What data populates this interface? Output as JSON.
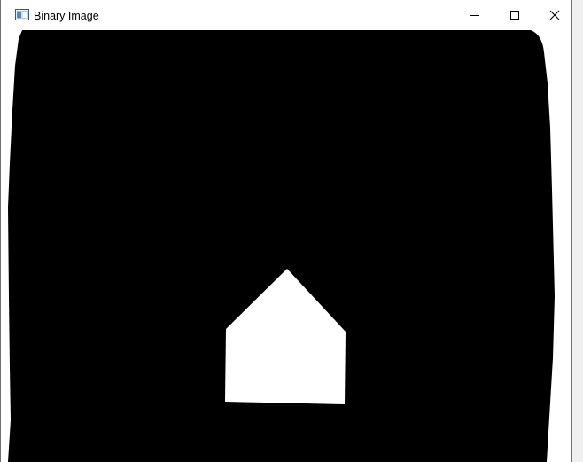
{
  "window": {
    "title": "Binary Image",
    "icon": "app-window-icon",
    "controls": {
      "minimize_icon": "minimize-icon",
      "maximize_icon": "maximize-icon",
      "close_icon": "close-icon"
    }
  },
  "colors": {
    "foreground": "#000000",
    "background": "#ffffff"
  }
}
